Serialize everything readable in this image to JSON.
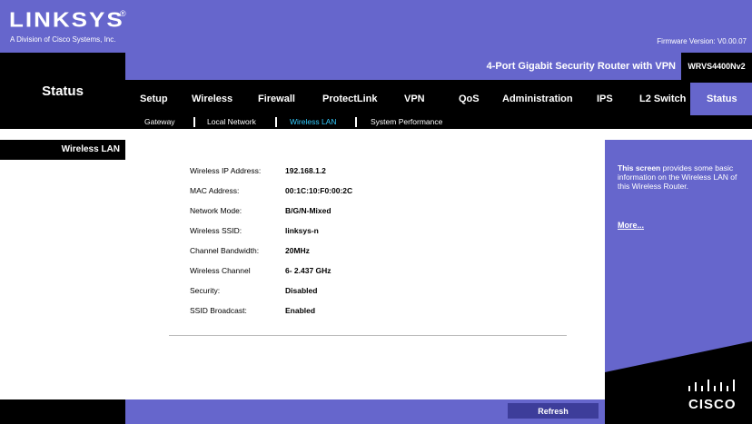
{
  "brand": {
    "logo": "LINKSYS",
    "registered": "®",
    "subtitle": "A Division of Cisco Systems, Inc.",
    "firmware": "Firmware Version: V0.00.07"
  },
  "product": {
    "name": "4-Port Gigabit Security Router with VPN",
    "model": "WRVS4400Nv2"
  },
  "page": {
    "title": "Status",
    "section": "Wireless LAN"
  },
  "nav": {
    "items": [
      "Setup",
      "Wireless",
      "Firewall",
      "ProtectLink",
      "VPN",
      "QoS",
      "Administration",
      "IPS",
      "L2 Switch",
      "Status"
    ],
    "active": "Status"
  },
  "subnav": {
    "items": [
      "Gateway",
      "Local Network",
      "Wireless LAN",
      "System Performance"
    ],
    "active": "Wireless LAN"
  },
  "wireless": {
    "rows": [
      {
        "label": "Wireless IP Address:",
        "value": "192.168.1.2"
      },
      {
        "label": "MAC Address:",
        "value": "00:1C:10:F0:00:2C"
      },
      {
        "label": "Network Mode:",
        "value": "B/G/N-Mixed"
      },
      {
        "label": "Wireless SSID:",
        "value": "linksys-n"
      },
      {
        "label": "Channel Bandwidth:",
        "value": "20MHz"
      },
      {
        "label": "Wireless Channel",
        "value": "6- 2.437 GHz"
      },
      {
        "label": "Security:",
        "value": "Disabled"
      },
      {
        "label": "SSID Broadcast:",
        "value": "Enabled"
      }
    ]
  },
  "help": {
    "bold": "This screen",
    "text": " provides some basic information on the Wireless LAN of this Wireless Router.",
    "more": "More..."
  },
  "cisco": {
    "wordmark": "CISCO"
  },
  "buttons": {
    "refresh": "Refresh"
  },
  "colors": {
    "accent": "#6666cc",
    "active_sub": "#33ccff",
    "dark": "#000000"
  }
}
